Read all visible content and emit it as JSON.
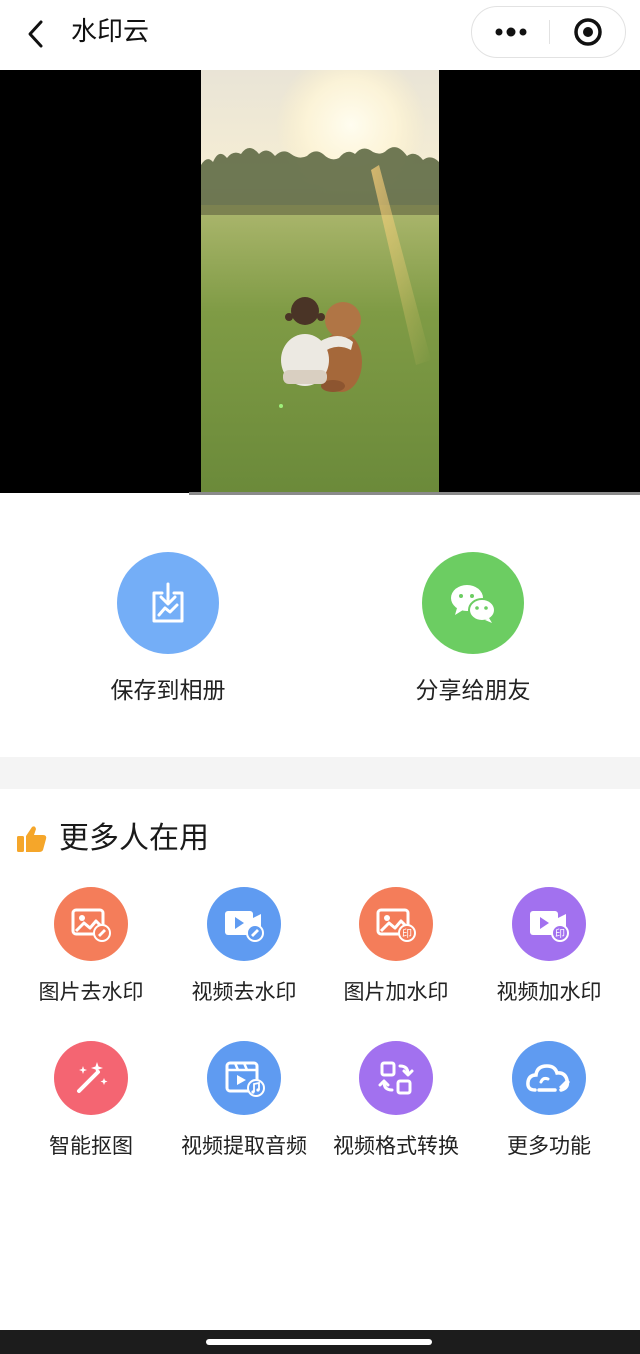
{
  "navbar": {
    "title": "水印云",
    "back_icon": "chevron-left-icon",
    "more_icon": "more-dots-icon",
    "close_icon": "target-circle-icon"
  },
  "video": {
    "description_icon": "video-preview",
    "progress": 0.0
  },
  "actions": [
    {
      "label": "保存到相册",
      "icon": "save-to-album-icon",
      "color": "#74aef7"
    },
    {
      "label": "分享给朋友",
      "icon": "wechat-icon",
      "color": "#6ccd62"
    }
  ],
  "more_section": {
    "title": "更多人在用",
    "icon": "thumbs-up-icon",
    "tools": [
      {
        "label": "图片去水印",
        "icon": "image-remove-watermark-icon",
        "color": "#f47d5a"
      },
      {
        "label": "视频去水印",
        "icon": "video-remove-watermark-icon",
        "color": "#5f9bf1"
      },
      {
        "label": "图片加水印",
        "icon": "image-add-watermark-icon",
        "color": "#f47d5a"
      },
      {
        "label": "视频加水印",
        "icon": "video-add-watermark-icon",
        "color": "#a271ef"
      },
      {
        "label": "智能抠图",
        "icon": "magic-wand-icon",
        "color": "#f46572"
      },
      {
        "label": "视频提取音频",
        "icon": "video-extract-audio-icon",
        "color": "#5f9bf1"
      },
      {
        "label": "视频格式转换",
        "icon": "format-convert-icon",
        "color": "#a271ef"
      },
      {
        "label": "更多功能",
        "icon": "cloud-more-icon",
        "color": "#5f9bf1"
      }
    ]
  },
  "badges": {
    "add_mark": "印"
  },
  "colors": {
    "thumb": "#f5a62a"
  }
}
